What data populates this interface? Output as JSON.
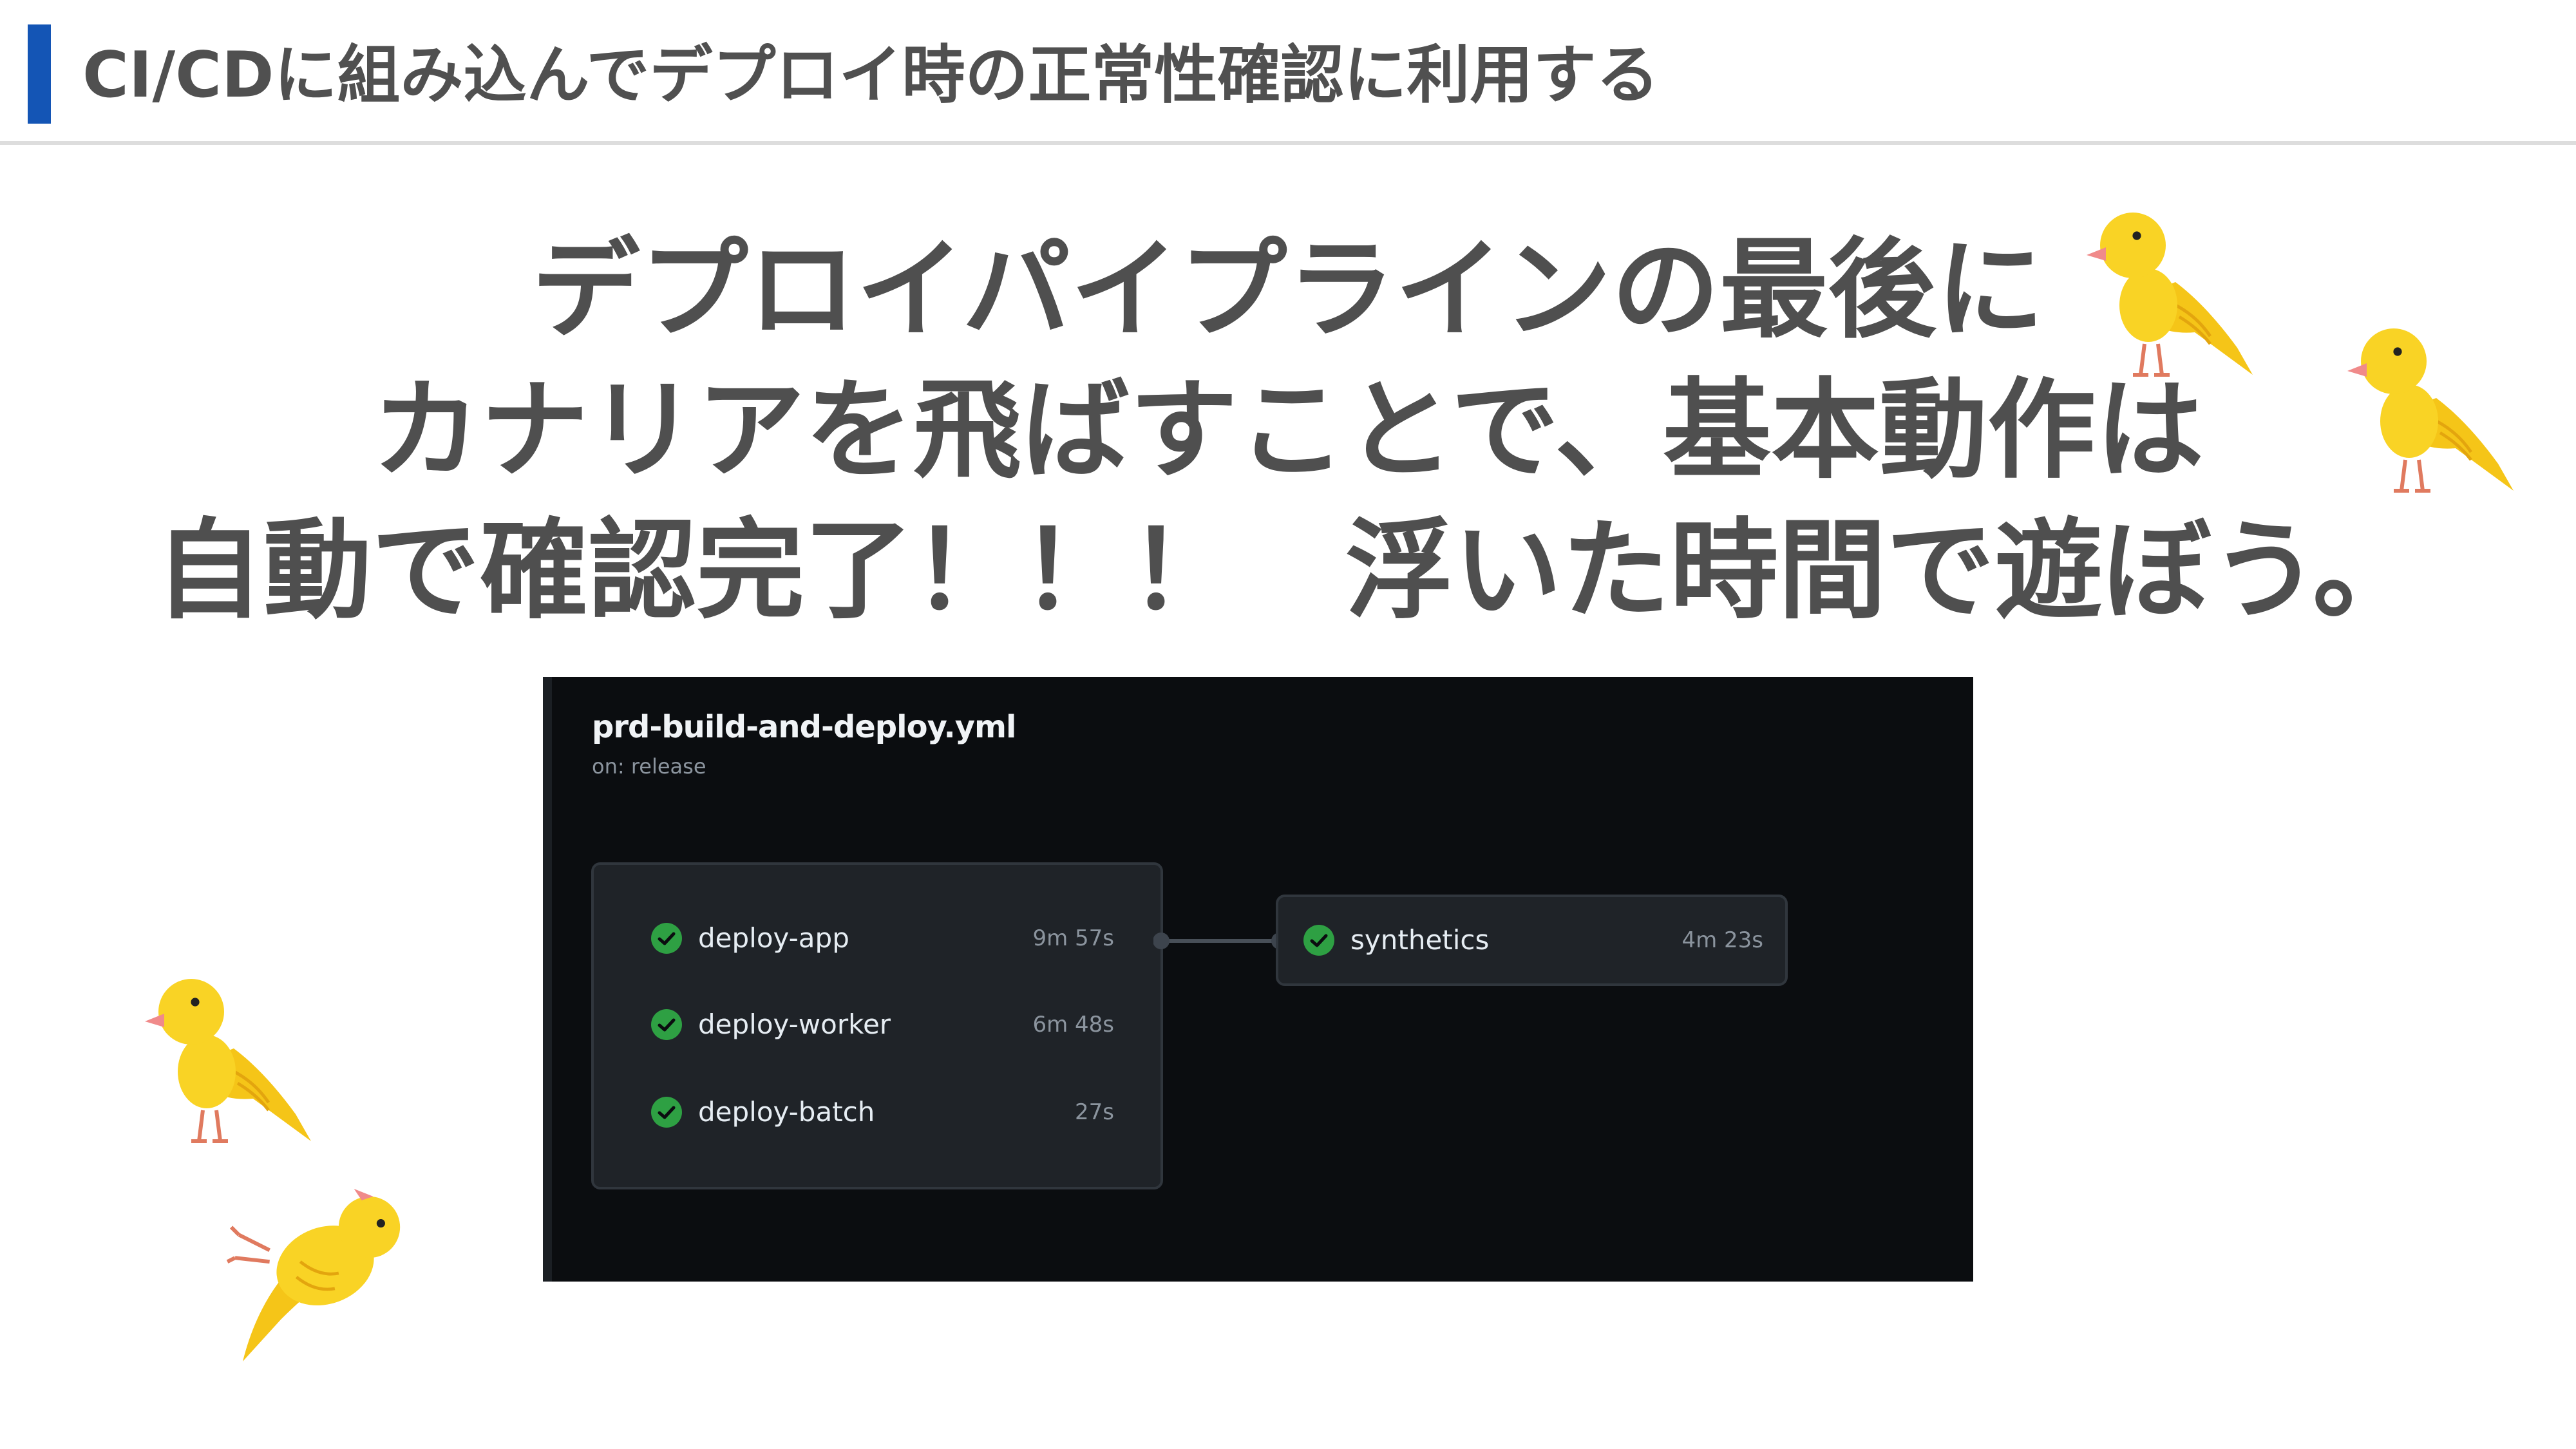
{
  "header": {
    "title": "CI/CDに組み込んでデプロイ時の正常性確認に利用する",
    "accent_color": "#1455b5"
  },
  "headline": {
    "line1": "デプロイパイプラインの最後に",
    "line2": "カナリアを飛ばすことで、基本動作は",
    "line3": "自動で確認完了！！！　浮いた時間で遊ぼう。"
  },
  "workflow": {
    "file": "prd-build-and-deploy.yml",
    "trigger": "on: release",
    "jobs": [
      {
        "name": "deploy-app",
        "duration": "9m 57s",
        "status": "success"
      },
      {
        "name": "deploy-worker",
        "duration": "6m 48s",
        "status": "success"
      },
      {
        "name": "deploy-batch",
        "duration": "27s",
        "status": "success"
      }
    ],
    "next_job": {
      "name": "synthetics",
      "duration": "4m 23s",
      "status": "success"
    },
    "success_color": "#2ea043"
  },
  "illustrations": [
    "canary-bird",
    "canary-bird",
    "canary-bird",
    "canary-bird-flying"
  ]
}
